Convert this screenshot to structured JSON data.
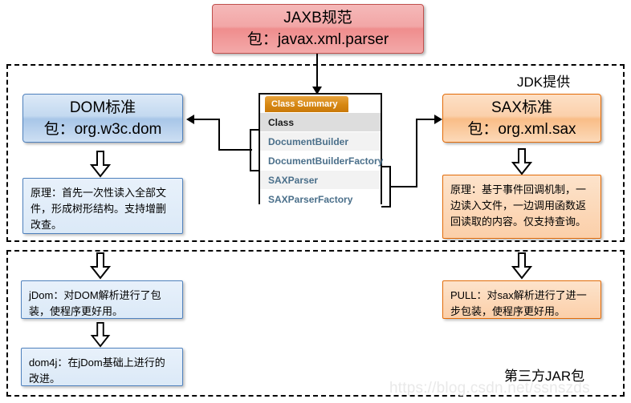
{
  "diagram": {
    "title_box": {
      "line1": "JAXB规范",
      "line2": "包：javax.xml.parser"
    },
    "regions": [
      {
        "id": "jdk",
        "label": "JDK提供"
      },
      {
        "id": "third-party",
        "label": "第三方JAR包"
      }
    ],
    "standards": {
      "dom": {
        "line1": "DOM标准",
        "line2": "包：org.w3c.dom"
      },
      "sax": {
        "line1": "SAX标准",
        "line2": "包：org.xml.sax"
      }
    },
    "principles": {
      "dom": "原理：首先一次性读入全部文件，形成树形结构。支持增删改查。",
      "sax": "原理：基于事件回调机制，一边读入文件，一边调用函数返回读取的内容。仅支持查询。"
    },
    "third_party": {
      "jdom": "jDom：对DOM解析进行了包装，使程序更好用。",
      "dom4j": "dom4j：在jDom基础上进行的改进。",
      "pull": "PULL：对sax解析进行了进一步包装，使程序更好用。"
    },
    "class_summary": {
      "tab_label": "Class Summary",
      "header": "Class",
      "rows": [
        "DocumentBuilder",
        "DocumentBuilderFactory",
        "SAXParser",
        "SAXParserFactory"
      ]
    },
    "watermark": "https://blog.csdn.net/ssnszds",
    "colors": {
      "pink": "#ef8d8d",
      "blue": "#a8c6e8",
      "orange": "#f9bd87",
      "tab_orange": "#d68712",
      "outline": "#000000"
    }
  }
}
